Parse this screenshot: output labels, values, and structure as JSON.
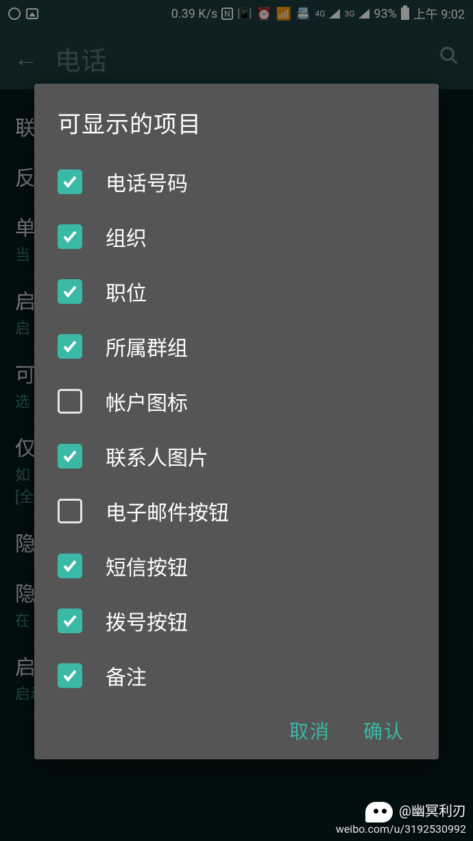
{
  "status": {
    "speed": "0.39 K/s",
    "battery_pct": "93%",
    "time": "上午 9:02",
    "net1_label": "4G",
    "net2_label": "3G"
  },
  "header": {
    "title": "电话"
  },
  "bg": {
    "items": [
      {
        "title": "联",
        "sub": ""
      },
      {
        "title": "反",
        "sub": ""
      },
      {
        "title": "单",
        "sub": "当"
      },
      {
        "title": "启",
        "sub": "启"
      },
      {
        "title": "可",
        "sub": "选"
      },
      {
        "title": "仅",
        "sub": "如\n[全"
      },
      {
        "title": "隐",
        "sub": ""
      },
      {
        "title": "隐",
        "sub": "在"
      },
      {
        "title": "启",
        "sub": "启动拨号器时隐藏拨号键盘"
      }
    ]
  },
  "dialog": {
    "title": "可显示的项目",
    "options": [
      {
        "label": "电话号码",
        "checked": true
      },
      {
        "label": "组织",
        "checked": true
      },
      {
        "label": "职位",
        "checked": true
      },
      {
        "label": "所属群组",
        "checked": true
      },
      {
        "label": "帐户图标",
        "checked": false
      },
      {
        "label": "联系人图片",
        "checked": true
      },
      {
        "label": "电子邮件按钮",
        "checked": false
      },
      {
        "label": "短信按钮",
        "checked": true
      },
      {
        "label": "拨号按钮",
        "checked": true
      },
      {
        "label": "备注",
        "checked": true
      }
    ],
    "cancel": "取消",
    "confirm": "确认"
  },
  "watermark": {
    "name": "@幽冥利刃",
    "url": "weibo.com/u/3192530992"
  }
}
